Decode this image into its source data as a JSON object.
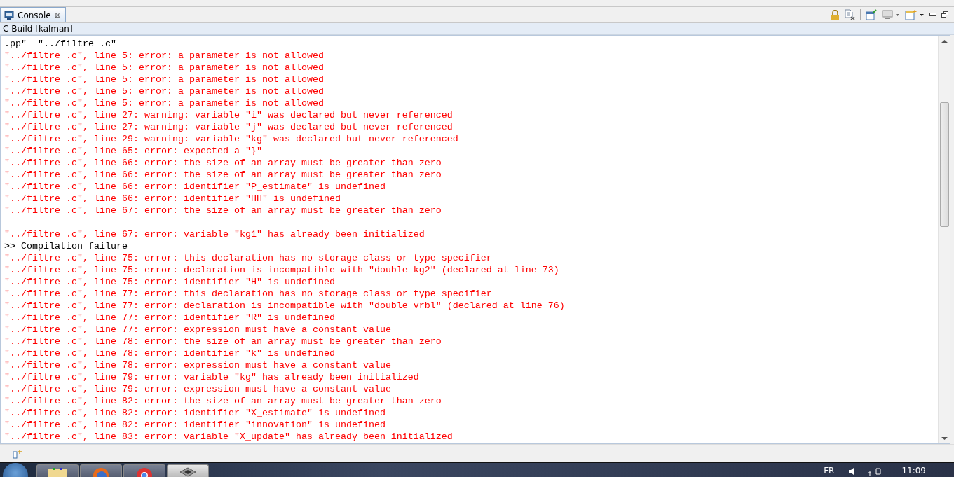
{
  "tab": {
    "label": "Console",
    "close": "⊠",
    "selected": true
  },
  "console_title": "C-Build [kalman]",
  "lines": [
    {
      "kind": "output",
      "text": ".pp\"  \"../filtre .c\""
    },
    {
      "kind": "error",
      "text": "\"../filtre .c\", line 5: error: a parameter is not allowed"
    },
    {
      "kind": "error",
      "text": "\"../filtre .c\", line 5: error: a parameter is not allowed"
    },
    {
      "kind": "error",
      "text": "\"../filtre .c\", line 5: error: a parameter is not allowed"
    },
    {
      "kind": "error",
      "text": "\"../filtre .c\", line 5: error: a parameter is not allowed"
    },
    {
      "kind": "error",
      "text": "\"../filtre .c\", line 5: error: a parameter is not allowed"
    },
    {
      "kind": "error",
      "text": "\"../filtre .c\", line 27: warning: variable \"i\" was declared but never referenced"
    },
    {
      "kind": "error",
      "text": "\"../filtre .c\", line 27: warning: variable \"j\" was declared but never referenced"
    },
    {
      "kind": "error",
      "text": "\"../filtre .c\", line 29: warning: variable \"kg\" was declared but never referenced"
    },
    {
      "kind": "error",
      "text": "\"../filtre .c\", line 65: error: expected a \"}\""
    },
    {
      "kind": "error",
      "text": "\"../filtre .c\", line 66: error: the size of an array must be greater than zero"
    },
    {
      "kind": "error",
      "text": "\"../filtre .c\", line 66: error: the size of an array must be greater than zero"
    },
    {
      "kind": "error",
      "text": "\"../filtre .c\", line 66: error: identifier \"P_estimate\" is undefined"
    },
    {
      "kind": "error",
      "text": "\"../filtre .c\", line 66: error: identifier \"HH\" is undefined"
    },
    {
      "kind": "error",
      "text": "\"../filtre .c\", line 67: error: the size of an array must be greater than zero"
    },
    {
      "kind": "blank"
    },
    {
      "kind": "error",
      "text": "\"../filtre .c\", line 67: error: variable \"kg1\" has already been initialized"
    },
    {
      "kind": "output",
      "text": ">> Compilation failure"
    },
    {
      "kind": "error",
      "text": "\"../filtre .c\", line 75: error: this declaration has no storage class or type specifier"
    },
    {
      "kind": "error",
      "text": "\"../filtre .c\", line 75: error: declaration is incompatible with \"double kg2\" (declared at line 73)"
    },
    {
      "kind": "error",
      "text": "\"../filtre .c\", line 75: error: identifier \"H\" is undefined"
    },
    {
      "kind": "error",
      "text": "\"../filtre .c\", line 77: error: this declaration has no storage class or type specifier"
    },
    {
      "kind": "error",
      "text": "\"../filtre .c\", line 77: error: declaration is incompatible with \"double vrbl\" (declared at line 76)"
    },
    {
      "kind": "error",
      "text": "\"../filtre .c\", line 77: error: identifier \"R\" is undefined"
    },
    {
      "kind": "error",
      "text": "\"../filtre .c\", line 77: error: expression must have a constant value"
    },
    {
      "kind": "error",
      "text": "\"../filtre .c\", line 78: error: the size of an array must be greater than zero"
    },
    {
      "kind": "error",
      "text": "\"../filtre .c\", line 78: error: identifier \"k\" is undefined"
    },
    {
      "kind": "error",
      "text": "\"../filtre .c\", line 78: error: expression must have a constant value"
    },
    {
      "kind": "error",
      "text": "\"../filtre .c\", line 79: error: variable \"kg\" has already been initialized"
    },
    {
      "kind": "error",
      "text": "\"../filtre .c\", line 79: error: expression must have a constant value"
    },
    {
      "kind": "error",
      "text": "\"../filtre .c\", line 82: error: the size of an array must be greater than zero"
    },
    {
      "kind": "error",
      "text": "\"../filtre .c\", line 82: error: identifier \"X_estimate\" is undefined"
    },
    {
      "kind": "error",
      "text": "\"../filtre .c\", line 82: error: identifier \"innovation\" is undefined"
    },
    {
      "kind": "error",
      "text": "\"../filtre .c\", line 83: error: variable \"X_update\" has already been initialized"
    }
  ],
  "taskbar": {
    "language": "FR",
    "clock": "11:09"
  }
}
